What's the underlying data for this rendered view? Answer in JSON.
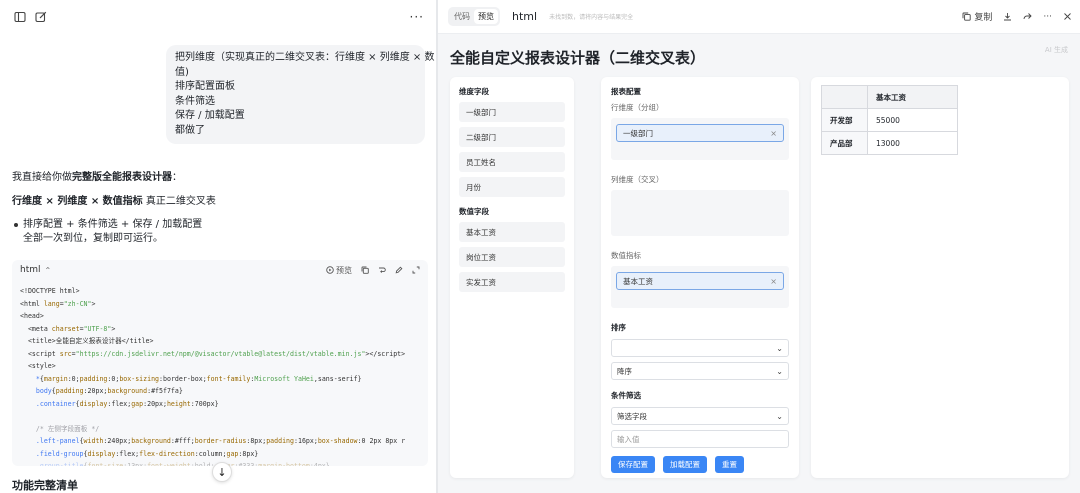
{
  "left": {
    "user_message": [
      "把列维度（实现真正的二维交叉表：行维度 × 列维度 × 数",
      "值)",
      "排序配置面板",
      "条件筛选",
      "保存 / 加载配置",
      "都做了"
    ],
    "reply": {
      "intro_prefix": "我直接给你做",
      "intro_bold": "完整版全能报表设计器",
      "intro_suffix": "：",
      "formula_bold": "行维度 × 列维度 × 数值指标",
      "formula_suffix": " 真正二维交叉表",
      "bullet_line1": "排序配置 + 条件筛选 + 保存 / 加载配置",
      "bullet_line2": "全部一次到位，复制即可运行。"
    },
    "code_block": {
      "language": "html",
      "preview_label": "预览"
    },
    "bottom_heading": "功能完整清单"
  },
  "preview": {
    "tab_code": "代码",
    "tab_preview": "预览",
    "title": "html",
    "hint": "未找到数，请将内容与结果完全",
    "copy_label": "复制",
    "page_title": "全能自定义报表设计器（二维交叉表）",
    "ai_label": "AI 生成",
    "dimension_title": "维度字段",
    "dimension_fields": [
      "一级部门",
      "二级部门",
      "员工姓名",
      "月份"
    ],
    "measure_title": "数值字段",
    "measure_fields": [
      "基本工资",
      "岗位工资",
      "实发工资"
    ],
    "config": {
      "title": "报表配置",
      "row_label": "行维度（分组）",
      "row_chip": "一级部门",
      "col_label": "列维度（交叉）",
      "value_label": "数值指标",
      "value_chip": "基本工资",
      "chip_close": "×",
      "sort_title": "排序",
      "sort_field": "",
      "sort_order": "降序",
      "filter_title": "条件筛选",
      "filter_field": "筛选字段",
      "filter_placeholder": "输入值",
      "btn_save": "保存配置",
      "btn_load": "加载配置",
      "btn_reset": "重置"
    },
    "result_table": {
      "header": [
        "",
        "基本工资"
      ],
      "rows": [
        {
          "label": "开发部",
          "value": "55000"
        },
        {
          "label": "产品部",
          "value": "13000"
        }
      ]
    }
  }
}
